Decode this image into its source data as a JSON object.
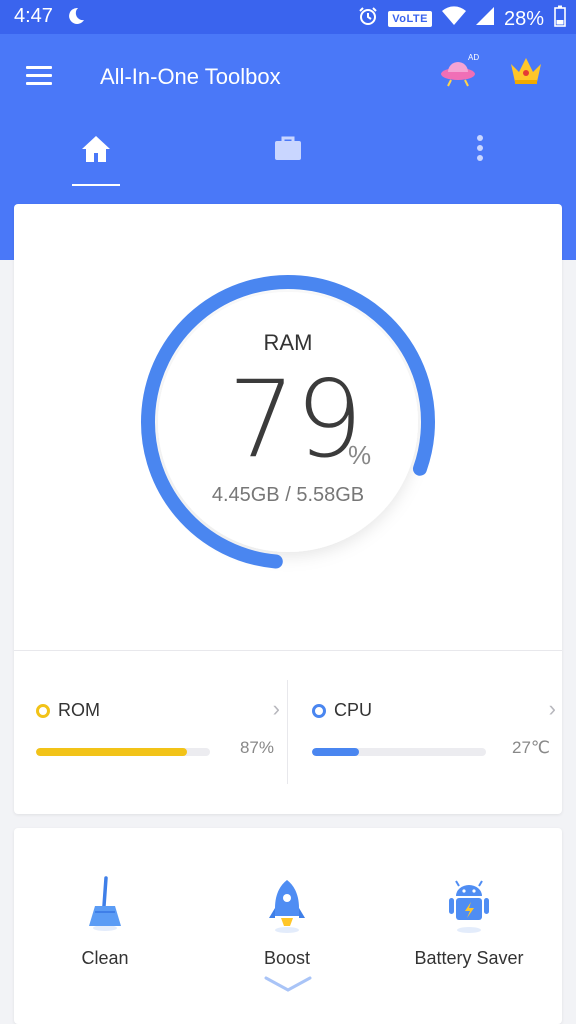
{
  "status_bar": {
    "time": "4:47",
    "network_label": "VoLTE",
    "battery": "28%"
  },
  "app_bar": {
    "title": "All-In-One Toolbox",
    "ad_badge": "AD"
  },
  "tabs": [
    {
      "icon": "home-icon",
      "active": true
    },
    {
      "icon": "briefcase-icon",
      "active": false
    },
    {
      "icon": "more-vert-icon",
      "active": false
    }
  ],
  "ram": {
    "label": "RAM",
    "value": "79",
    "unit": "%",
    "memory": "4.45GB / 5.58GB",
    "fraction": 0.79
  },
  "stats": {
    "rom": {
      "label": "ROM",
      "value": "87%",
      "fraction": 0.87,
      "color": "#f2c318"
    },
    "cpu": {
      "label": "CPU",
      "value": "27℃",
      "fraction": 0.27,
      "color": "#4a86f0"
    }
  },
  "actions": [
    {
      "label": "Clean",
      "icon": "broom-icon"
    },
    {
      "label": "Boost",
      "icon": "rocket-icon"
    },
    {
      "label": "Battery Saver",
      "icon": "android-battery-icon"
    }
  ],
  "colors": {
    "accent": "#4a78f8",
    "status_bar": "#3a64ee",
    "gauge": "#4a86f0"
  }
}
